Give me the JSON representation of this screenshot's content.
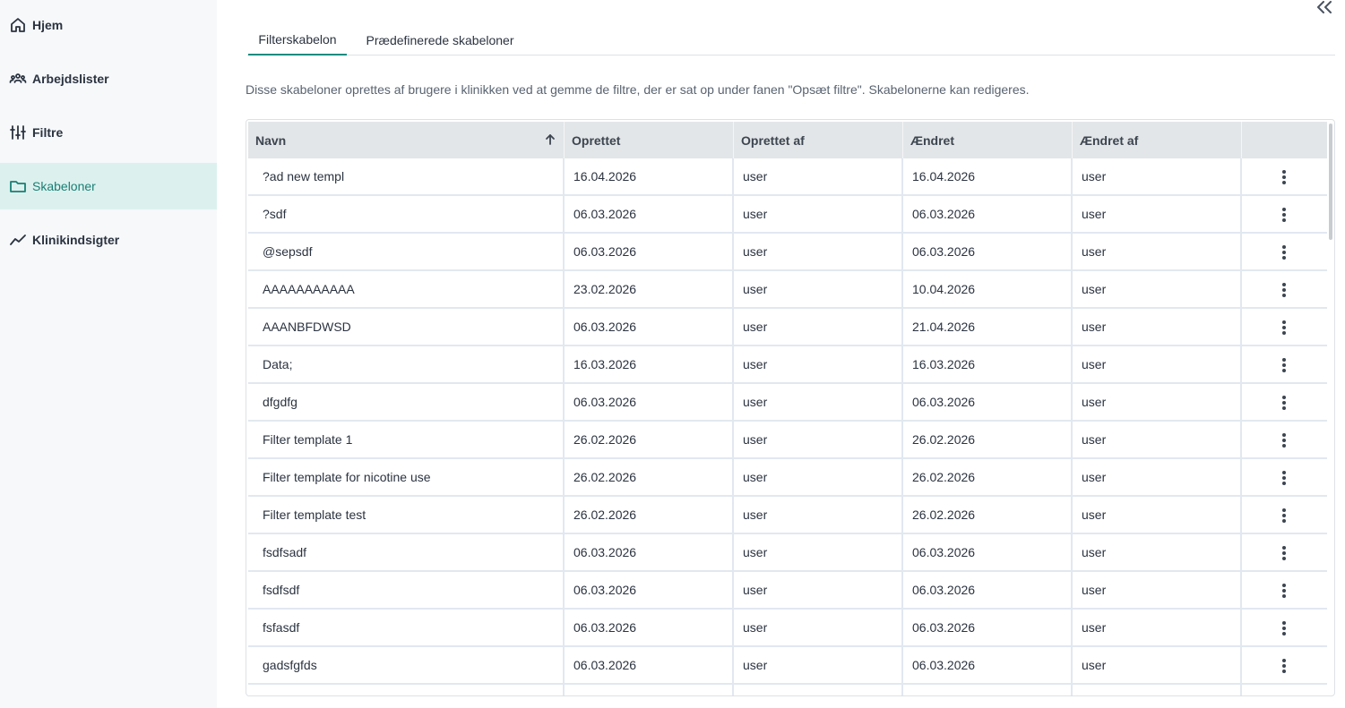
{
  "sidebar": {
    "items": [
      {
        "label": "Hjem",
        "icon": "home-icon"
      },
      {
        "label": "Arbejdslister",
        "icon": "users-icon"
      },
      {
        "label": "Filtre",
        "icon": "sliders-icon"
      },
      {
        "label": "Skabeloner",
        "icon": "folder-icon",
        "active": true
      },
      {
        "label": "Klinikindsigter",
        "icon": "trend-icon"
      }
    ]
  },
  "tabs": [
    {
      "label": "Filterskabelon",
      "active": true
    },
    {
      "label": "Prædefinerede skabeloner",
      "active": false
    }
  ],
  "description": "Disse skabeloner oprettes af brugere i klinikken ved at gemme de filtre, der er sat op under fanen \"Opsæt filtre\". Skabelonerne kan redigeres.",
  "table": {
    "columns": [
      "Navn",
      "Oprettet",
      "Oprettet af",
      "Ændret",
      "Ændret af"
    ],
    "sort": {
      "column": "Navn",
      "direction": "ascending"
    },
    "rows": [
      [
        "?ad new templ",
        "16.04.2026",
        "user",
        "16.04.2026",
        "user"
      ],
      [
        "?sdf",
        "06.03.2026",
        "user",
        "06.03.2026",
        "user"
      ],
      [
        "@sepsdf",
        "06.03.2026",
        "user",
        "06.03.2026",
        "user"
      ],
      [
        "AAAAAAAAAAA",
        "23.02.2026",
        "user",
        "10.04.2026",
        "user"
      ],
      [
        "AAANBFDWSD",
        "06.03.2026",
        "user",
        "21.04.2026",
        "user"
      ],
      [
        "Data;",
        "16.03.2026",
        "user",
        "16.03.2026",
        "user"
      ],
      [
        "dfgdfg",
        "06.03.2026",
        "user",
        "06.03.2026",
        "user"
      ],
      [
        "Filter template 1",
        "26.02.2026",
        "user",
        "26.02.2026",
        "user"
      ],
      [
        "Filter template for nicotine use",
        "26.02.2026",
        "user",
        "26.02.2026",
        "user"
      ],
      [
        "Filter template test",
        "26.02.2026",
        "user",
        "26.02.2026",
        "user"
      ],
      [
        "fsdfsadf",
        "06.03.2026",
        "user",
        "06.03.2026",
        "user"
      ],
      [
        "fsdfsdf",
        "06.03.2026",
        "user",
        "06.03.2026",
        "user"
      ],
      [
        "fsfasdf",
        "06.03.2026",
        "user",
        "06.03.2026",
        "user"
      ],
      [
        "gadsfgfds",
        "06.03.2026",
        "user",
        "06.03.2026",
        "user"
      ],
      [
        "",
        "",
        "",
        "",
        ""
      ]
    ]
  },
  "colors": {
    "accent": "#1a8a80",
    "active_bg": "#dcf1ee",
    "header_bg": "#e3e6e8"
  }
}
